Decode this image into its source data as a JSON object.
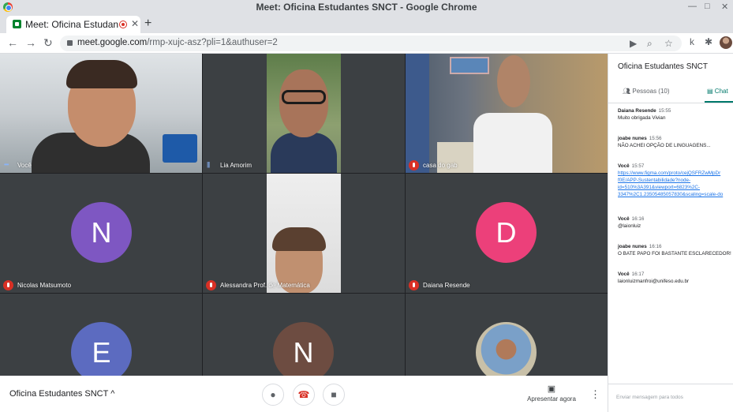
{
  "window": {
    "title": "Meet: Oficina Estudantes SNCT - Google Chrome",
    "controls": [
      "—",
      "□",
      "✕"
    ]
  },
  "tab": {
    "title": "Meet: Oficina Estudan",
    "close": "✕",
    "new_tab": "+"
  },
  "address": {
    "host": "meet.google.com",
    "path": "/rmp-xujc-asz?pli=1&authuser=2",
    "profile_letter": "k"
  },
  "nav": {
    "back": "←",
    "forward": "→",
    "reload": "↻"
  },
  "tiles": [
    {
      "name": "Você",
      "status": "audio",
      "kind": "video"
    },
    {
      "name": "Lia Amorim",
      "status": "audio",
      "kind": "video"
    },
    {
      "name": "casa do gab",
      "status": "muted",
      "kind": "video"
    },
    {
      "name": "Nicolas Matsumoto",
      "status": "muted",
      "kind": "avatar",
      "initial": "N",
      "color": "#7e57c2"
    },
    {
      "name": "Alessandra Prof. de Matemática",
      "status": "muted",
      "kind": "video"
    },
    {
      "name": "Daiana Resende",
      "status": "muted",
      "kind": "avatar",
      "initial": "D",
      "color": "#ec407a"
    },
    {
      "name": "",
      "status": "",
      "kind": "avatar",
      "initial": "E",
      "color": "#5c6bc0"
    },
    {
      "name": "",
      "status": "",
      "kind": "avatar",
      "initial": "N",
      "color": "#6d4c41"
    },
    {
      "name": "",
      "status": "",
      "kind": "photo"
    }
  ],
  "bottom_bar": {
    "meeting_name": "Oficina Estudantes SNCT",
    "chevron": "^",
    "present_label": "Apresentar agora",
    "more": "⋮"
  },
  "panel": {
    "title": "Oficina Estudantes SNCT",
    "tabs": {
      "people": "Pessoas (10)",
      "chat": "Chat"
    },
    "messages": [
      {
        "sender": "Daiana Resende",
        "time": "15:55",
        "lines": [
          "Muito obrigada Vivian"
        ]
      },
      {
        "sender": "joabe nunes",
        "time": "15:56",
        "lines": [
          "NÃO ACHEI OPÇÃO DE LINGUAGENS..."
        ]
      },
      {
        "sender": "Você",
        "time": "15:57",
        "link": true,
        "lines": [
          "https://www.figma.com/proto/cejQSFRZwMpDr",
          "f0E/APP-Sustentabilidade?node-",
          "id=510%3A391&viewport=6823%2C-",
          "3347%2C1.23505485057830&scaling=scale-do"
        ]
      },
      {
        "sender": "Você",
        "time": "16:16",
        "lines": [
          "@laionluiz"
        ]
      },
      {
        "sender": "joabe nunes",
        "time": "16:16",
        "lines": [
          "O BATE PAPO FOI BASTANTE ESCLARECEDOR!"
        ]
      },
      {
        "sender": "Você",
        "time": "16:17",
        "lines": [
          "laionluizmanfroi@unifeso.edu.br"
        ]
      }
    ],
    "input_placeholder": "Enviar mensagem para todos"
  },
  "colors": {
    "stage_bg": "#202124",
    "mute_red": "#d93025",
    "chat_accent": "#00796b",
    "link_blue": "#1a73e8"
  }
}
